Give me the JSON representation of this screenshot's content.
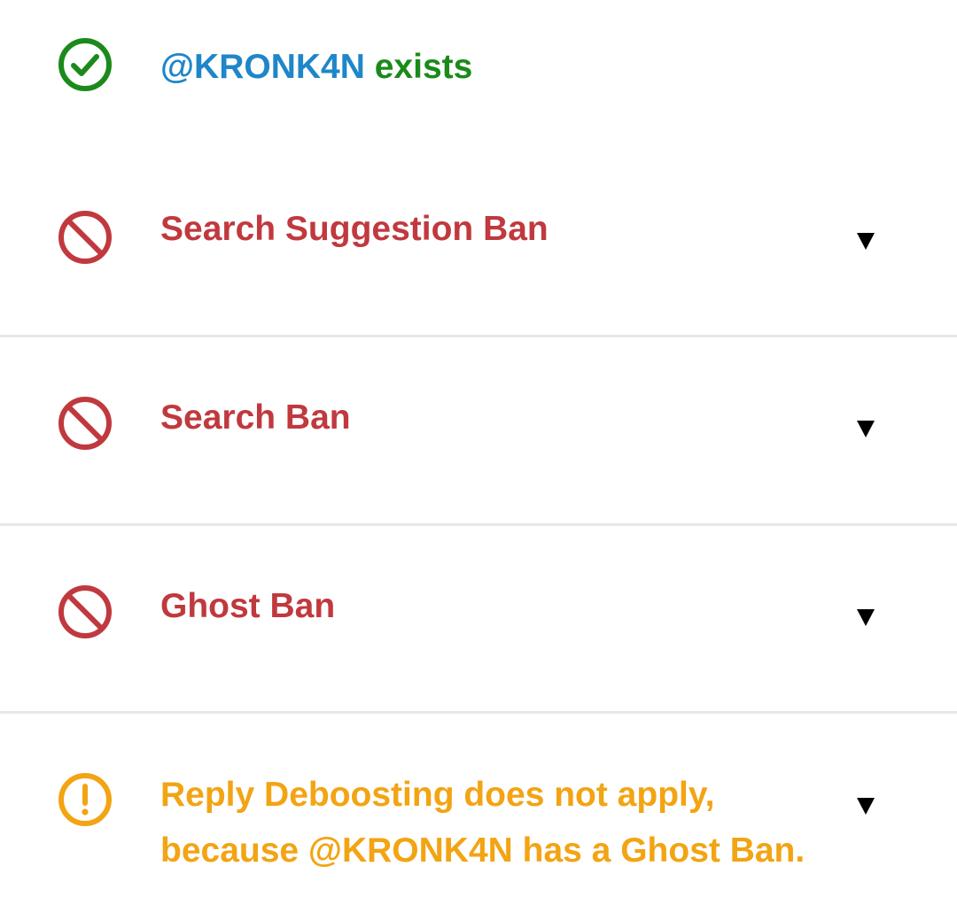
{
  "exists": {
    "handle": "@KRONK4N",
    "status": "exists",
    "icon": "check-circle-icon"
  },
  "bans": [
    {
      "label": "Search Suggestion Ban",
      "icon": "ban-icon",
      "toggle": "▼"
    },
    {
      "label": "Search Ban",
      "icon": "ban-icon",
      "toggle": "▼"
    },
    {
      "label": "Ghost Ban",
      "icon": "ban-icon",
      "toggle": "▼"
    }
  ],
  "reply_deboosting": {
    "line1": "Reply Deboosting does not apply,",
    "line2": "because @KRONK4N has a Ghost Ban.",
    "icon": "warning-circle-icon",
    "toggle": "▼"
  },
  "colors": {
    "ban": "#c0393e",
    "ok": "#1b8a1b",
    "handle": "#1f86c8",
    "warning": "#f2a413",
    "divider": "#e3e8ec"
  }
}
